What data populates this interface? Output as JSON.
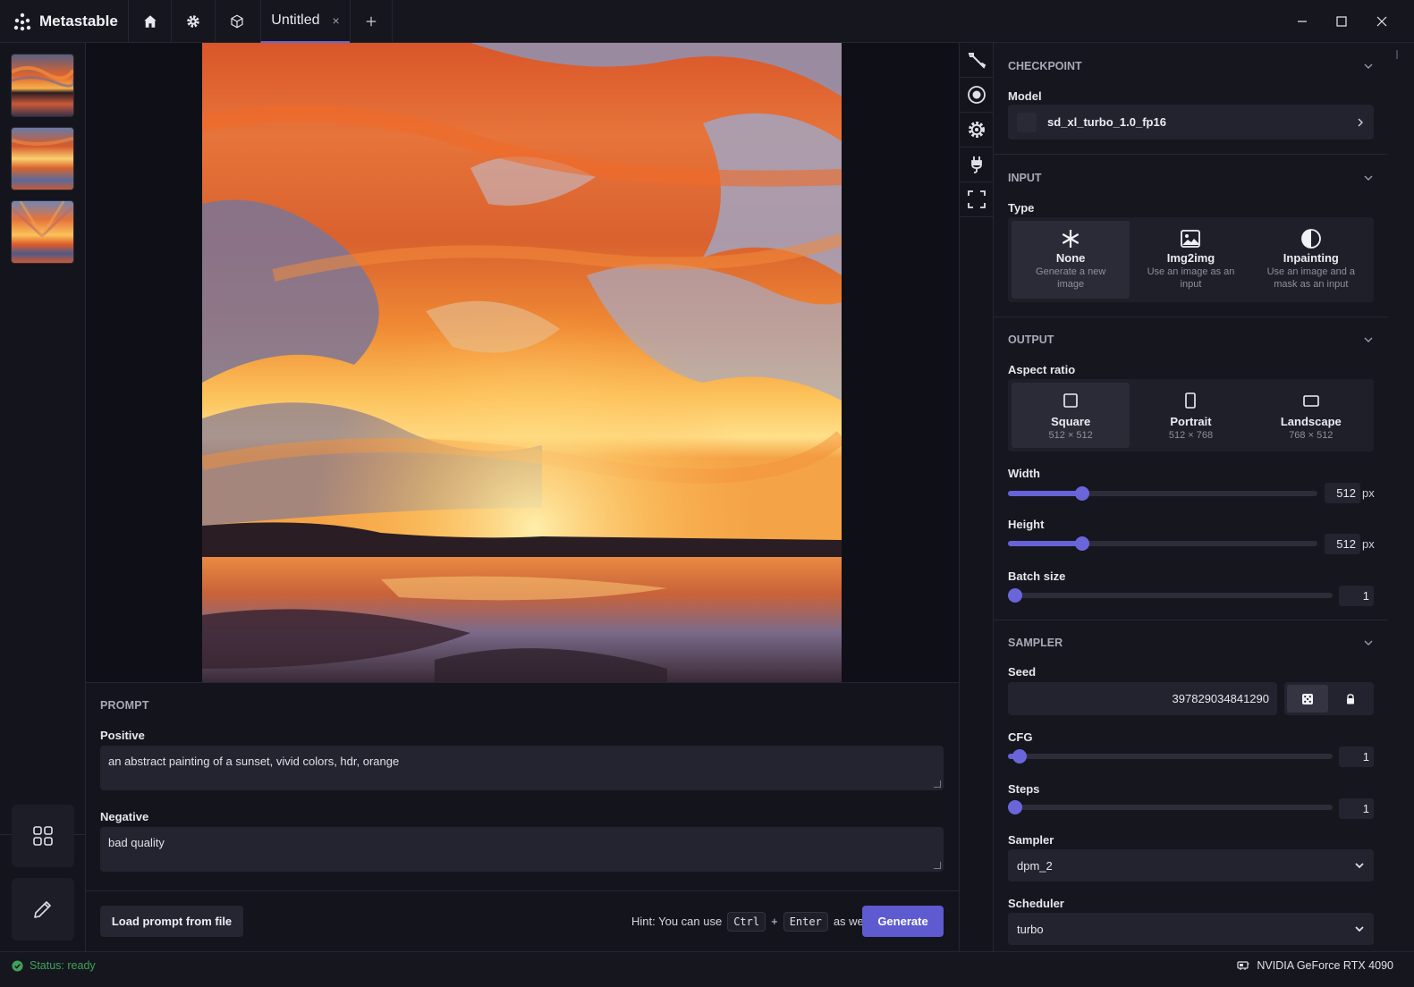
{
  "app": {
    "name": "Metastable"
  },
  "tabs": {
    "active_label": "Untitled",
    "close_glyph": "×",
    "add_glyph": "+"
  },
  "prompt": {
    "section_title": "PROMPT",
    "positive_label": "Positive",
    "positive_value": "an abstract painting of a sunset, vivid colors, hdr, orange",
    "negative_label": "Negative",
    "negative_value": "bad quality",
    "load_button": "Load prompt from file",
    "hint_prefix": "Hint: You can use",
    "hint_key1": "Ctrl",
    "hint_plus": "+",
    "hint_key2": "Enter",
    "hint_suffix": "as well.",
    "generate_button": "Generate"
  },
  "settings": {
    "checkpoint": {
      "title": "CHECKPOINT",
      "model_label": "Model",
      "model_value": "sd_xl_turbo_1.0_fp16"
    },
    "input": {
      "title": "INPUT",
      "type_label": "Type",
      "options": [
        {
          "title": "None",
          "desc": "Generate a new image",
          "icon": "asterisk-icon",
          "selected": true
        },
        {
          "title": "Img2img",
          "desc": "Use an image as an input",
          "icon": "image-icon",
          "selected": false
        },
        {
          "title": "Inpainting",
          "desc": "Use an image and a mask as an input",
          "icon": "half-circle-icon",
          "selected": false
        }
      ]
    },
    "output": {
      "title": "OUTPUT",
      "aspect_label": "Aspect ratio",
      "aspects": [
        {
          "title": "Square",
          "size": "512 × 512",
          "selected": true
        },
        {
          "title": "Portrait",
          "size": "512 × 768",
          "selected": false
        },
        {
          "title": "Landscape",
          "size": "768 × 512",
          "selected": false
        }
      ],
      "width_label": "Width",
      "width_value": "512",
      "width_unit": "px",
      "width_fraction": 0.24,
      "height_label": "Height",
      "height_value": "512",
      "height_unit": "px",
      "height_fraction": 0.24,
      "batch_label": "Batch size",
      "batch_value": "1",
      "batch_fraction": 0.0
    },
    "sampler": {
      "title": "SAMPLER",
      "seed_label": "Seed",
      "seed_value": "397829034841290",
      "cfg_label": "CFG",
      "cfg_value": "1",
      "cfg_fraction": 0.035,
      "steps_label": "Steps",
      "steps_value": "1",
      "steps_fraction": 0.0,
      "sampler_label": "Sampler",
      "sampler_value": "dpm_2",
      "scheduler_label": "Scheduler",
      "scheduler_value": "turbo"
    }
  },
  "status": {
    "text": "Status: ready",
    "gpu": "NVIDIA GeForce RTX 4090"
  },
  "colors": {
    "accent": "#6762d6",
    "status_ok": "#3fa25a",
    "background": "#0f0f17",
    "panel": "#16161f"
  }
}
